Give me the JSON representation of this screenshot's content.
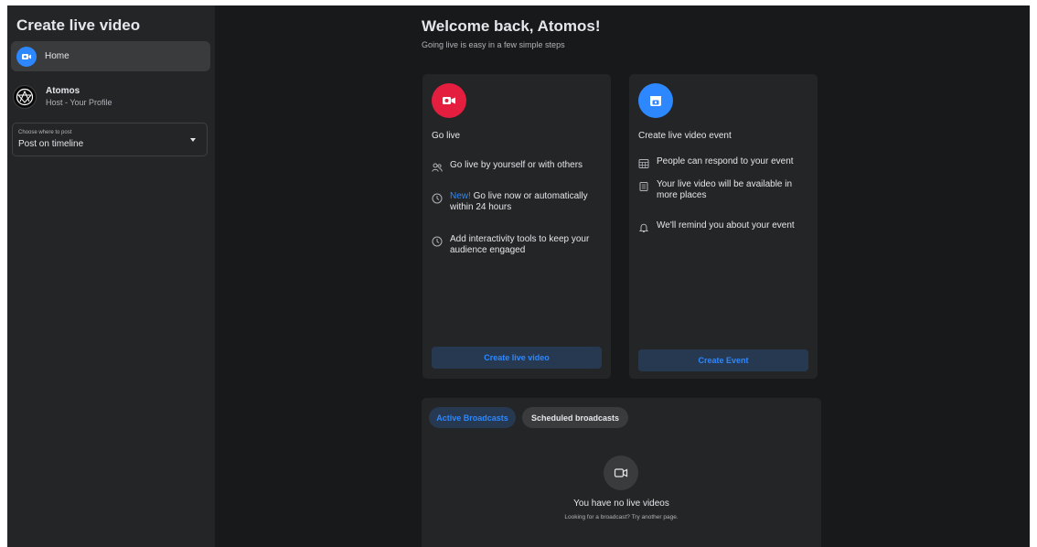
{
  "sidebar": {
    "title": "Create live video",
    "nav": {
      "home_label": "Home"
    },
    "profile": {
      "name": "Atomos",
      "role": "Host - Your Profile"
    },
    "post_select": {
      "caption": "Choose where to post",
      "value": "Post on timeline"
    }
  },
  "main": {
    "title": "Welcome back, Atomos!",
    "subtitle": "Going live is easy in a few simple steps",
    "go_live_card": {
      "title": "Go live",
      "features": [
        {
          "icon": "people-icon",
          "text": "Go live by yourself or with others"
        },
        {
          "icon": "clock-icon",
          "badge": "New!",
          "text": " Go live now or automatically within 24 hours"
        },
        {
          "icon": "clock-icon",
          "text": "Add interactivity tools to keep your audience engaged"
        }
      ],
      "button_label": "Create live video"
    },
    "event_card": {
      "title": "Create live video event",
      "features": [
        {
          "icon": "calendar-grid-icon",
          "text": "People can respond to your event"
        },
        {
          "icon": "newsfeed-icon",
          "text": "Your live video will be available in more places"
        },
        {
          "icon": "bell-icon",
          "text": "We'll remind you about your event"
        }
      ],
      "button_label": "Create Event"
    },
    "broadcasts": {
      "tabs": [
        {
          "label": "Active Broadcasts",
          "active": true
        },
        {
          "label": "Scheduled broadcasts",
          "active": false
        }
      ],
      "empty_title": "You have no live videos",
      "empty_subtitle": "Looking for a broadcast? Try another page."
    }
  },
  "colors": {
    "background": "#18191a",
    "sidebar": "#242526",
    "card": "#242526",
    "accent_blue": "#2d88ff",
    "live_red": "#e41e3f",
    "text_primary": "#e4e6eb",
    "text_secondary": "#b0b3b8"
  }
}
